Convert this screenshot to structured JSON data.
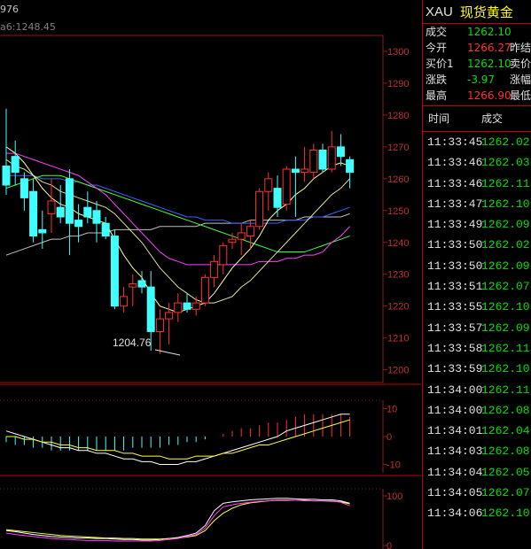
{
  "chart": {
    "top_indicator": "976",
    "ma_label": "a6:1248.45",
    "low_annotation": "1204.76",
    "price_axis": [
      "1300",
      "1290",
      "1280",
      "1270",
      "1260",
      "1250",
      "1240",
      "1230",
      "1220",
      "1210",
      "1200"
    ],
    "macd_axis": [
      "10",
      "0",
      "-10"
    ],
    "kdj_axis": [
      "100",
      "0"
    ],
    "colors": {
      "up": "#ff3030",
      "down": "#40ffff",
      "grid": "#8b1a1a",
      "ma1": "#ffffa0",
      "ma2": "#ff40ff",
      "ma3": "#40ff40",
      "ma4": "#4060ff",
      "ma5": "#c0c0c0"
    }
  },
  "chart_data": {
    "type": "candlestick",
    "ylim": [
      1196,
      1305
    ],
    "candles": [
      {
        "o": 1264,
        "h": 1282,
        "l": 1255,
        "c": 1258
      },
      {
        "o": 1267,
        "h": 1272,
        "l": 1258,
        "c": 1262
      },
      {
        "o": 1260,
        "h": 1262,
        "l": 1250,
        "c": 1254
      },
      {
        "o": 1256,
        "h": 1260,
        "l": 1240,
        "c": 1242
      },
      {
        "o": 1244,
        "h": 1250,
        "l": 1238,
        "c": 1243
      },
      {
        "o": 1249,
        "h": 1260,
        "l": 1243,
        "c": 1253
      },
      {
        "o": 1251,
        "h": 1258,
        "l": 1246,
        "c": 1248
      },
      {
        "o": 1260,
        "h": 1263,
        "l": 1236,
        "c": 1246
      },
      {
        "o": 1247,
        "h": 1252,
        "l": 1240,
        "c": 1245
      },
      {
        "o": 1251,
        "h": 1256,
        "l": 1246,
        "c": 1248
      },
      {
        "o": 1250,
        "h": 1253,
        "l": 1240,
        "c": 1246
      },
      {
        "o": 1246,
        "h": 1248,
        "l": 1241,
        "c": 1242
      },
      {
        "o": 1242,
        "h": 1244,
        "l": 1219,
        "c": 1220
      },
      {
        "o": 1220,
        "h": 1226,
        "l": 1218,
        "c": 1223
      },
      {
        "o": 1226,
        "h": 1230,
        "l": 1220,
        "c": 1227
      },
      {
        "o": 1228,
        "h": 1231,
        "l": 1224,
        "c": 1226
      },
      {
        "o": 1226,
        "h": 1231,
        "l": 1206,
        "c": 1212
      },
      {
        "o": 1212,
        "h": 1219,
        "l": 1205,
        "c": 1216
      },
      {
        "o": 1216,
        "h": 1221,
        "l": 1208,
        "c": 1218
      },
      {
        "o": 1218,
        "h": 1224,
        "l": 1215,
        "c": 1221
      },
      {
        "o": 1221,
        "h": 1224,
        "l": 1218,
        "c": 1219
      },
      {
        "o": 1219,
        "h": 1223,
        "l": 1217,
        "c": 1221
      },
      {
        "o": 1221,
        "h": 1230,
        "l": 1220,
        "c": 1229
      },
      {
        "o": 1229,
        "h": 1236,
        "l": 1226,
        "c": 1234
      },
      {
        "o": 1233,
        "h": 1240,
        "l": 1230,
        "c": 1239
      },
      {
        "o": 1240,
        "h": 1243,
        "l": 1238,
        "c": 1241
      },
      {
        "o": 1241,
        "h": 1246,
        "l": 1236,
        "c": 1243
      },
      {
        "o": 1242,
        "h": 1247,
        "l": 1238,
        "c": 1245
      },
      {
        "o": 1245,
        "h": 1257,
        "l": 1244,
        "c": 1256
      },
      {
        "o": 1256,
        "h": 1262,
        "l": 1250,
        "c": 1260
      },
      {
        "o": 1257,
        "h": 1261,
        "l": 1248,
        "c": 1251
      },
      {
        "o": 1252,
        "h": 1264,
        "l": 1250,
        "c": 1263
      },
      {
        "o": 1263,
        "h": 1267,
        "l": 1248,
        "c": 1262
      },
      {
        "o": 1262,
        "h": 1270,
        "l": 1259,
        "c": 1263
      },
      {
        "o": 1262,
        "h": 1271,
        "l": 1260,
        "c": 1269
      },
      {
        "o": 1269,
        "h": 1271,
        "l": 1262,
        "c": 1263
      },
      {
        "o": 1263,
        "h": 1275,
        "l": 1262,
        "c": 1270
      },
      {
        "o": 1270,
        "h": 1274,
        "l": 1264,
        "c": 1267
      },
      {
        "o": 1266,
        "h": 1267,
        "l": 1257,
        "c": 1262
      }
    ],
    "ma_fast": [
      1270,
      1268,
      1265,
      1261,
      1257,
      1254,
      1252,
      1251,
      1249,
      1248,
      1247,
      1246,
      1241,
      1236,
      1232,
      1229,
      1224,
      1220,
      1219,
      1218,
      1219,
      1220,
      1221,
      1224,
      1228,
      1232,
      1235,
      1238,
      1242,
      1247,
      1250,
      1252,
      1255,
      1257,
      1260,
      1262,
      1264,
      1265,
      1264
    ],
    "ma_slow": [
      1266,
      1264,
      1263,
      1261,
      1259,
      1258,
      1256,
      1255,
      1254,
      1253,
      1252,
      1251,
      1249,
      1246,
      1243,
      1240,
      1236,
      1232,
      1229,
      1226,
      1224,
      1222,
      1221,
      1221,
      1222,
      1223,
      1226,
      1228,
      1231,
      1234,
      1237,
      1240,
      1243,
      1246,
      1249,
      1252,
      1255,
      1257,
      1260
    ],
    "ma_magenta": [
      1268,
      1268,
      1267,
      1266,
      1265,
      1264,
      1263,
      1262,
      1261,
      1259,
      1257,
      1255,
      1252,
      1249,
      1246,
      1243,
      1240,
      1237,
      1235,
      1234,
      1233,
      1233,
      1233,
      1233,
      1233,
      1233,
      1233,
      1233,
      1234,
      1234,
      1234,
      1235,
      1235,
      1236,
      1236,
      1237,
      1240,
      1242,
      1245
    ],
    "ma_green": [
      1257,
      1258,
      1259,
      1260,
      1261,
      1261,
      1261,
      1260,
      1259,
      1258,
      1257,
      1256,
      1255,
      1254,
      1253,
      1252,
      1251,
      1250,
      1249,
      1248,
      1247,
      1246,
      1245,
      1244,
      1243,
      1242,
      1241,
      1240,
      1239,
      1238,
      1237,
      1237,
      1237,
      1237,
      1238,
      1239,
      1240,
      1241,
      1242
    ],
    "ma_blue": [
      1261,
      1261,
      1261,
      1261,
      1260,
      1260,
      1260,
      1259,
      1259,
      1258,
      1258,
      1257,
      1256,
      1255,
      1254,
      1253,
      1252,
      1251,
      1250,
      1249,
      1248,
      1248,
      1247,
      1247,
      1247,
      1246,
      1246,
      1246,
      1246,
      1246,
      1246,
      1247,
      1247,
      1247,
      1248,
      1248,
      1249,
      1250,
      1251
    ],
    "ma_gray": [
      1236,
      1237,
      1238,
      1239,
      1240,
      1241,
      1241,
      1242,
      1242,
      1243,
      1243,
      1243,
      1244,
      1244,
      1244,
      1244,
      1244,
      1245,
      1245,
      1245,
      1245,
      1245,
      1246,
      1246,
      1246,
      1246,
      1246,
      1247,
      1247,
      1247,
      1247,
      1247,
      1247,
      1248,
      1248,
      1248,
      1248,
      1248,
      1249
    ],
    "macd_hist": [
      -2,
      -3,
      -3,
      -4,
      -4,
      -5,
      -5,
      -5,
      -5,
      -5,
      -5,
      -5,
      -5,
      -5,
      -4,
      -4,
      -4,
      -4,
      -3,
      -3,
      -2,
      -2,
      -1,
      0,
      1,
      2,
      3,
      3,
      4,
      5,
      5,
      6,
      7,
      8,
      8,
      8,
      8,
      8,
      7
    ],
    "macd_dif": [
      2,
      1,
      0,
      -1,
      -2,
      -3,
      -4,
      -4,
      -5,
      -5,
      -6,
      -6,
      -7,
      -8,
      -8,
      -9,
      -9,
      -10,
      -10,
      -10,
      -9,
      -9,
      -8,
      -7,
      -6,
      -5,
      -4,
      -3,
      -2,
      -1,
      0,
      2,
      3,
      4,
      5,
      6,
      7,
      8,
      8
    ],
    "macd_dea": [
      0,
      0,
      -1,
      -1,
      -2,
      -2,
      -3,
      -3,
      -4,
      -4,
      -5,
      -5,
      -5,
      -6,
      -6,
      -7,
      -7,
      -7,
      -8,
      -8,
      -8,
      -7,
      -7,
      -7,
      -6,
      -6,
      -5,
      -4,
      -3,
      -3,
      -2,
      -1,
      0,
      1,
      2,
      3,
      4,
      5,
      6
    ],
    "kdj_k": [
      30,
      28,
      25,
      22,
      20,
      18,
      17,
      16,
      15,
      15,
      14,
      14,
      13,
      12,
      12,
      11,
      11,
      12,
      14,
      16,
      20,
      25,
      40,
      70,
      85,
      88,
      90,
      92,
      93,
      94,
      95,
      95,
      94,
      93,
      93,
      92,
      92,
      90,
      85
    ],
    "kdj_d": [
      32,
      30,
      28,
      26,
      24,
      22,
      20,
      19,
      18,
      17,
      16,
      15,
      15,
      14,
      14,
      13,
      13,
      13,
      14,
      15,
      17,
      20,
      30,
      50,
      65,
      75,
      82,
      86,
      88,
      90,
      91,
      91,
      91,
      91,
      90,
      90,
      89,
      88,
      84
    ],
    "kdj_j": [
      25,
      22,
      20,
      18,
      16,
      14,
      13,
      12,
      11,
      10,
      10,
      10,
      9,
      9,
      9,
      9,
      9,
      10,
      12,
      14,
      18,
      22,
      35,
      60,
      78,
      82,
      85,
      87,
      89,
      90,
      92,
      92,
      91,
      90,
      90,
      90,
      90,
      87,
      80
    ]
  },
  "quote": {
    "symbol": "XAU",
    "name": "现货黄金",
    "rows": [
      {
        "label": "成交",
        "value": "1262.10",
        "color": "green",
        "label2": ""
      },
      {
        "label": "今开",
        "value": "1266.27",
        "color": "red",
        "label2": "昨结"
      },
      {
        "label": "买价1",
        "value": "1262.10",
        "color": "green",
        "label2": "卖价"
      },
      {
        "label": "涨跌",
        "value": "-3.97",
        "color": "green",
        "label2": "涨幅"
      },
      {
        "label": "最高",
        "value": "1266.90",
        "color": "red",
        "label2": "最低"
      }
    ]
  },
  "ticks": {
    "header_time": "时间",
    "header_price": "成交",
    "rows": [
      {
        "time": "11:33:45",
        "price": "1262.02"
      },
      {
        "time": "11:33:46",
        "price": "1262.03"
      },
      {
        "time": "11:33:46",
        "price": "1262.11"
      },
      {
        "time": "11:33:47",
        "price": "1262.10"
      },
      {
        "time": "11:33:49",
        "price": "1262.09"
      },
      {
        "time": "11:33:50",
        "price": "1262.02"
      },
      {
        "time": "11:33:50",
        "price": "1262.09"
      },
      {
        "time": "11:33:51",
        "price": "1262.07"
      },
      {
        "time": "11:33:55",
        "price": "1262.10"
      },
      {
        "time": "11:33:57",
        "price": "1262.09"
      },
      {
        "time": "11:33:58",
        "price": "1262.11"
      },
      {
        "time": "11:33:59",
        "price": "1262.10"
      },
      {
        "time": "11:34:00",
        "price": "1262.11"
      },
      {
        "time": "11:34:00",
        "price": "1262.08"
      },
      {
        "time": "11:34:01",
        "price": "1262.04"
      },
      {
        "time": "11:34:03",
        "price": "1262.08"
      },
      {
        "time": "11:34:04",
        "price": "1262.05"
      },
      {
        "time": "11:34:05",
        "price": "1262.07"
      },
      {
        "time": "11:34:06",
        "price": "1262.10"
      }
    ]
  }
}
